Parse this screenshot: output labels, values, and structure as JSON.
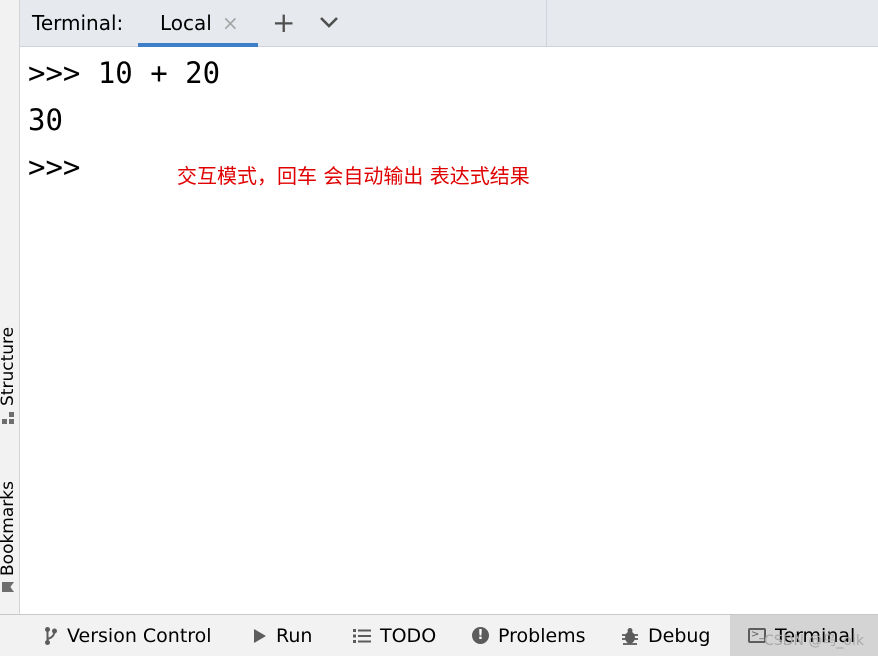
{
  "left_sidebar": {
    "structure_label": "Structure",
    "bookmarks_label": "Bookmarks"
  },
  "tab_bar": {
    "label": "Terminal:",
    "active_tab": "Local",
    "close_glyph": "×",
    "add_glyph": "+"
  },
  "terminal": {
    "lines": [
      ">>> 10 + 20",
      "30",
      ">>>"
    ]
  },
  "annotation": "交互模式，回车 会自动输出 表达式结果",
  "bottom_toolbar": {
    "items": [
      {
        "label": "Version Control",
        "icon": "branch-icon"
      },
      {
        "label": "Run",
        "icon": "play-icon"
      },
      {
        "label": "TODO",
        "icon": "list-icon"
      },
      {
        "label": "Problems",
        "icon": "exclamation-icon"
      },
      {
        "label": "Debug",
        "icon": "bug-icon"
      },
      {
        "label": "Terminal",
        "icon": "terminal-icon",
        "active": true
      }
    ]
  },
  "watermark": "CSDN @乌_oik",
  "colors": {
    "tab_bar_bg": "#e6e9ee",
    "active_tab_underline": "#3f7ec9",
    "annotation": "#e00000",
    "toolbar_bg": "#f2f2f2",
    "active_toolbar_bg": "#d4d4d4"
  }
}
